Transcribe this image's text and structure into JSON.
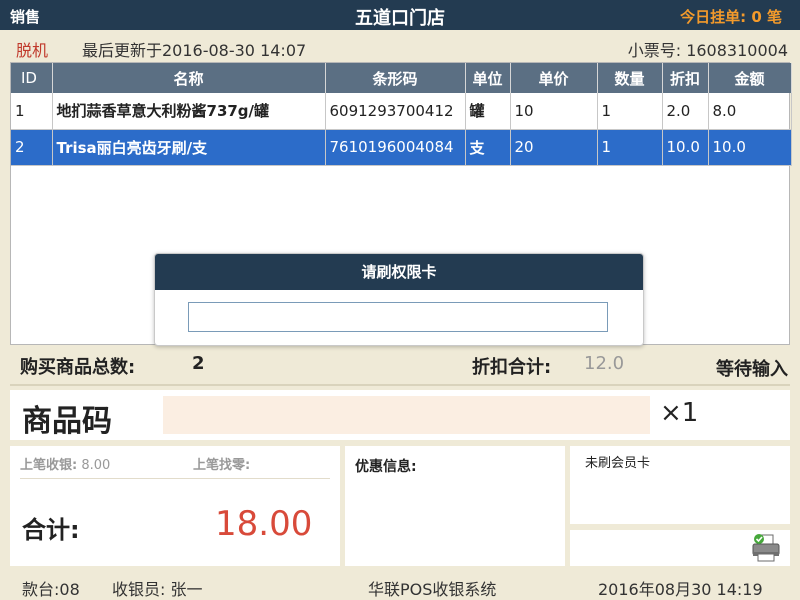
{
  "header": {
    "mode": "销售",
    "store_name": "五道口门店",
    "today_pending": "今日挂单: 0 笔"
  },
  "status": {
    "offline": "脱机",
    "last_updated": "最后更新于2016-08-30 14:07",
    "receipt": "小票号: 1608310004"
  },
  "table": {
    "columns": [
      "ID",
      "名称",
      "条形码",
      "单位",
      "单价",
      "数量",
      "折扣",
      "金额"
    ],
    "rows": [
      {
        "id": "1",
        "name": "地扪蒜香草意大利粉酱737g/罐",
        "barcode": "6091293700412",
        "unit": "罐",
        "price": "10",
        "qty": "1",
        "discount": "2.0",
        "amount": "8.0"
      },
      {
        "id": "2",
        "name": "Trisa丽白亮齿牙刷/支",
        "barcode": "7610196004084",
        "unit": "支",
        "price": "20",
        "qty": "1",
        "discount": "10.0",
        "amount": "10.0"
      }
    ]
  },
  "dialog": {
    "title": "请刷权限卡",
    "input_value": ""
  },
  "summary": {
    "count_label": "购买商品总数:",
    "count_value": "2",
    "discount_label": "折扣合计:",
    "discount_value": "12.0",
    "status_text": "等待输入"
  },
  "code_bar": {
    "label": "商品码",
    "input_value": "",
    "qty": "×1"
  },
  "payment": {
    "last_pay_label": "上笔收银:",
    "last_pay_value": "8.00",
    "last_change_label": "上笔找零:",
    "last_change_value": "",
    "total_label": "合计:",
    "total_value": "18.00"
  },
  "promo": {
    "label": "优惠信息:"
  },
  "member": {
    "status": "未刷会员卡"
  },
  "footer": {
    "terminal": "款台:08",
    "cashier": "收银员: 张一",
    "system_name": "华联POS收银系统",
    "datetime": "2016年08月30  14:19"
  },
  "icons": {
    "printer": "printer-icon"
  },
  "colors": {
    "header_bg": "#233b51",
    "accent_orange": "#f39a2b",
    "selected_row": "#2c6cc9",
    "total_red": "#d84a3a",
    "offline_red": "#c0392b"
  }
}
